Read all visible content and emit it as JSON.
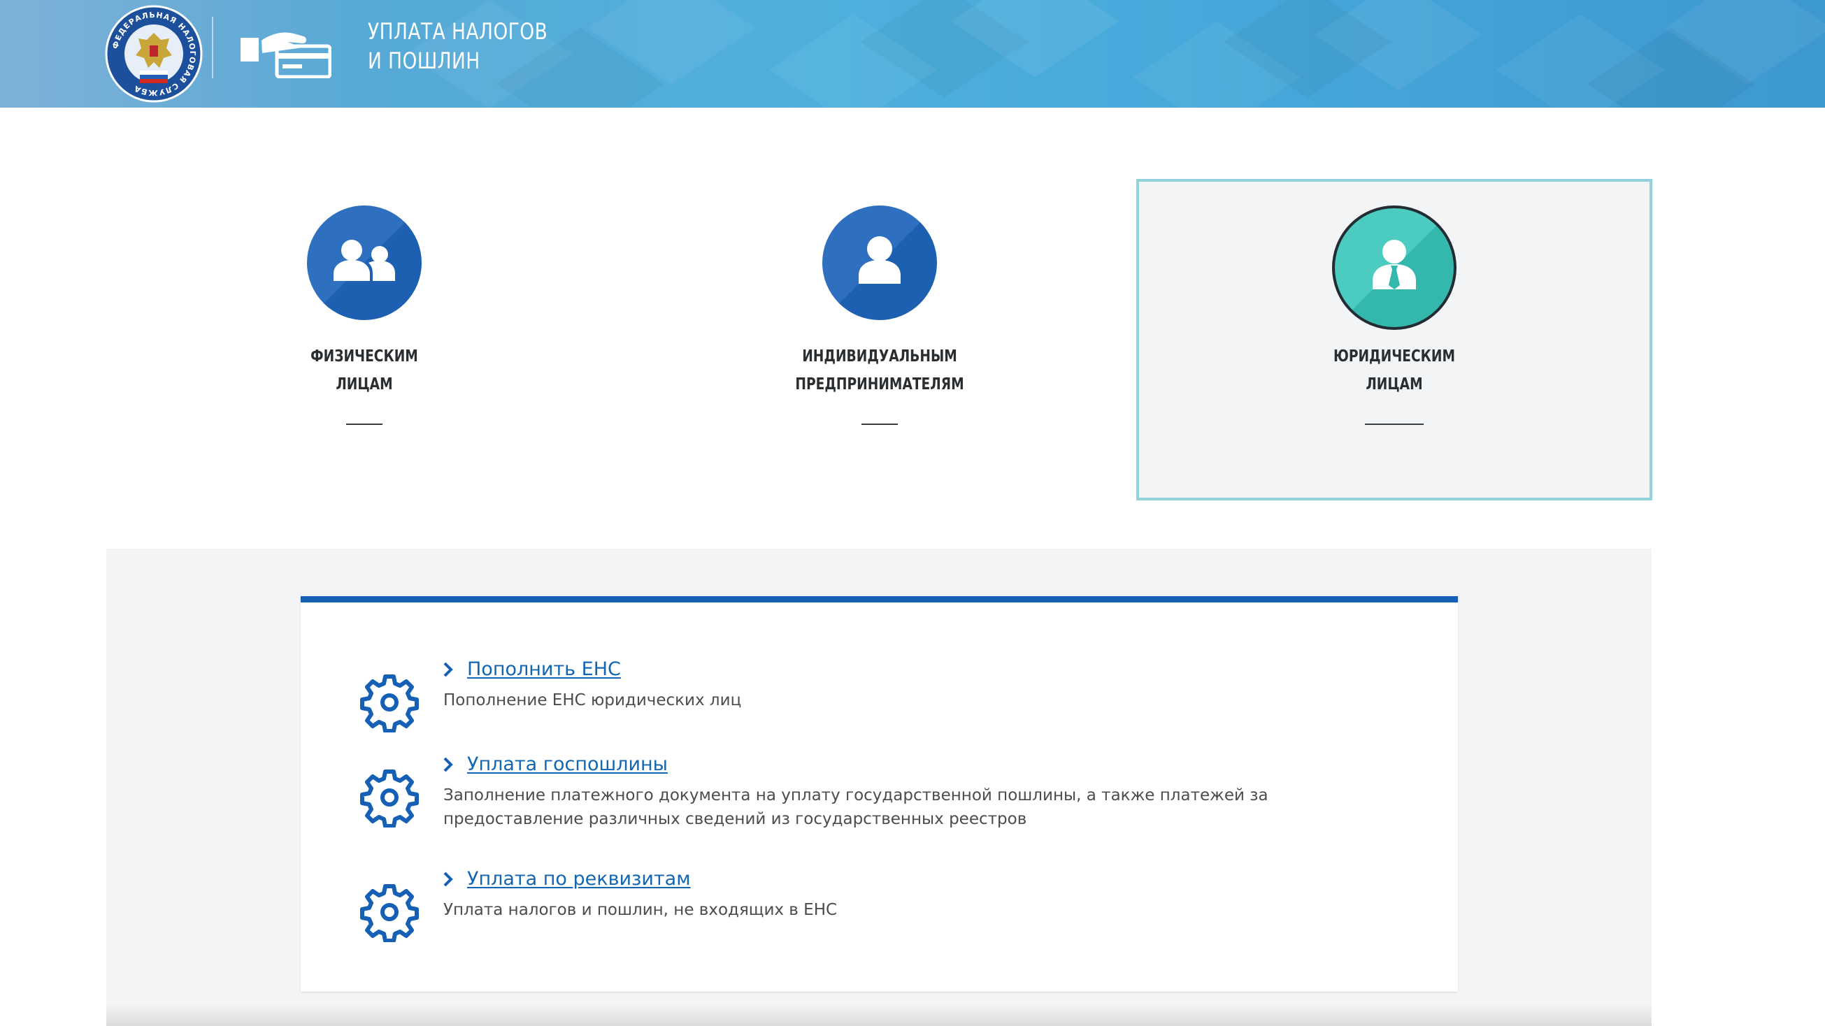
{
  "header": {
    "title_line1": "УПЛАТА НАЛОГОВ",
    "title_line2": "И ПОШЛИН",
    "logo_ring_text": "ФЕДЕРАЛЬНАЯ НАЛОГОВАЯ СЛУЖБА",
    "logo_icon": "fns-emblem-icon",
    "service_icon": "card-hand-icon"
  },
  "categories": [
    {
      "line1": "ФИЗИЧЕСКИМ",
      "line2": "ЛИЦАМ",
      "icon": "people-icon",
      "active": false
    },
    {
      "line1": "ИНДИВИДУАЛЬНЫМ",
      "line2": "ПРЕДПРИНИМАТЕЛЯМ",
      "icon": "person-icon",
      "active": false
    },
    {
      "line1": "ЮРИДИЧЕСКИМ",
      "line2": "ЛИЦАМ",
      "icon": "businessman-icon",
      "active": true
    }
  ],
  "services": [
    {
      "link": "Пополнить ЕНС",
      "desc": "Пополнение ЕНС юридических лиц",
      "icon": "gear-icon"
    },
    {
      "link": "Уплата госпошлины",
      "desc": "Заполнение платежного документа на уплату государственной пошлины, а также платежей за предоставление различных сведений из государственных реестров",
      "icon": "gear-icon"
    },
    {
      "link": "Уплата по реквизитам",
      "desc": "Уплата налогов и пошлин, не входящих в ЕНС",
      "icon": "gear-icon"
    }
  ],
  "colors": {
    "header_blue": "#47a9db",
    "circle_blue": "#1d5fb1",
    "circle_teal": "#34b8ad",
    "active_border": "#93d1dc",
    "link_blue": "#1366b1",
    "card_top_border": "#1560b5"
  }
}
